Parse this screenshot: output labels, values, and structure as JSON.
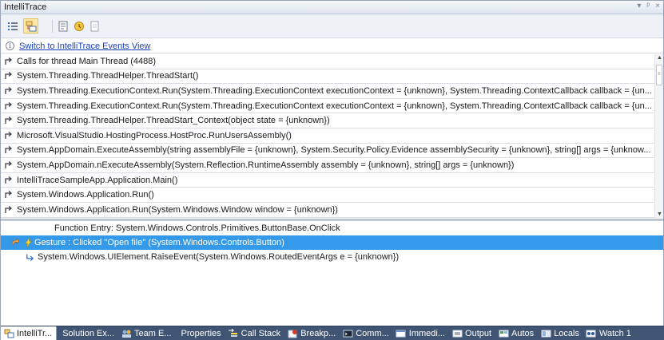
{
  "window": {
    "title": "IntelliTrace",
    "controls": [
      "▾",
      "ᵖ",
      "×"
    ]
  },
  "toolbar": {
    "buttons": [
      {
        "icon": "list-view-icon"
      },
      {
        "icon": "calls-view-icon",
        "active": true
      },
      {
        "icon": "settings-icon"
      },
      {
        "icon": "open-log-icon"
      },
      {
        "icon": "help-icon"
      }
    ]
  },
  "infobar": {
    "icon": "i",
    "link": "Switch to IntelliTrace Events View"
  },
  "calls": [
    "Calls for thread Main Thread (4488)",
    "System.Threading.ThreadHelper.ThreadStart()",
    "System.Threading.ExecutionContext.Run(System.Threading.ExecutionContext executionContext = {unknown}, System.Threading.ContextCallback callback = {un...",
    "System.Threading.ExecutionContext.Run(System.Threading.ExecutionContext executionContext = {unknown}, System.Threading.ContextCallback callback = {un...",
    "System.Threading.ThreadHelper.ThreadStart_Context(object state = {unknown})",
    "Microsoft.VisualStudio.HostingProcess.HostProc.RunUsersAssembly()",
    "System.AppDomain.ExecuteAssembly(string assemblyFile = {unknown}, System.Security.Policy.Evidence assemblySecurity = {unknown}, string[] args = {unknow...",
    "System.AppDomain.nExecuteAssembly(System.Reflection.RuntimeAssembly assembly = {unknown}, string[] args = {unknown})",
    "IntelliTraceSampleApp.Application.Main()",
    "System.Windows.Application.Run()",
    "System.Windows.Application.Run(System.Windows.Window window = {unknown})"
  ],
  "detail": {
    "function_entry": "Function Entry: System.Windows.Controls.Primitives.ButtonBase.OnClick",
    "gesture": "Gesture : Clicked \"Open file\" (System.Windows.Controls.Button)",
    "raise_event": "System.Windows.UIElement.RaiseEvent(System.Windows.RoutedEventArgs e = {unknown})"
  },
  "tabs": [
    {
      "label": "IntelliTr...",
      "icon": "intellitrace-icon",
      "active": true
    },
    {
      "label": "Solution Ex...",
      "icon": ""
    },
    {
      "label": "Team E...",
      "icon": "team-explorer-icon"
    },
    {
      "label": "Properties",
      "icon": ""
    },
    {
      "label": "Call Stack",
      "icon": "call-stack-icon"
    },
    {
      "label": "Breakp...",
      "icon": "breakpoints-icon"
    },
    {
      "label": "Comm...",
      "icon": "command-window-icon"
    },
    {
      "label": "Immedi...",
      "icon": "immediate-window-icon"
    },
    {
      "label": "Output",
      "icon": "output-icon"
    },
    {
      "label": "Autos",
      "icon": "autos-icon"
    },
    {
      "label": "Locals",
      "icon": "locals-icon"
    },
    {
      "label": "Watch 1",
      "icon": "watch-icon"
    }
  ],
  "colors": {
    "selection": "#3399e8",
    "tabbar": "#3f5573",
    "link": "#1a3fb8"
  }
}
